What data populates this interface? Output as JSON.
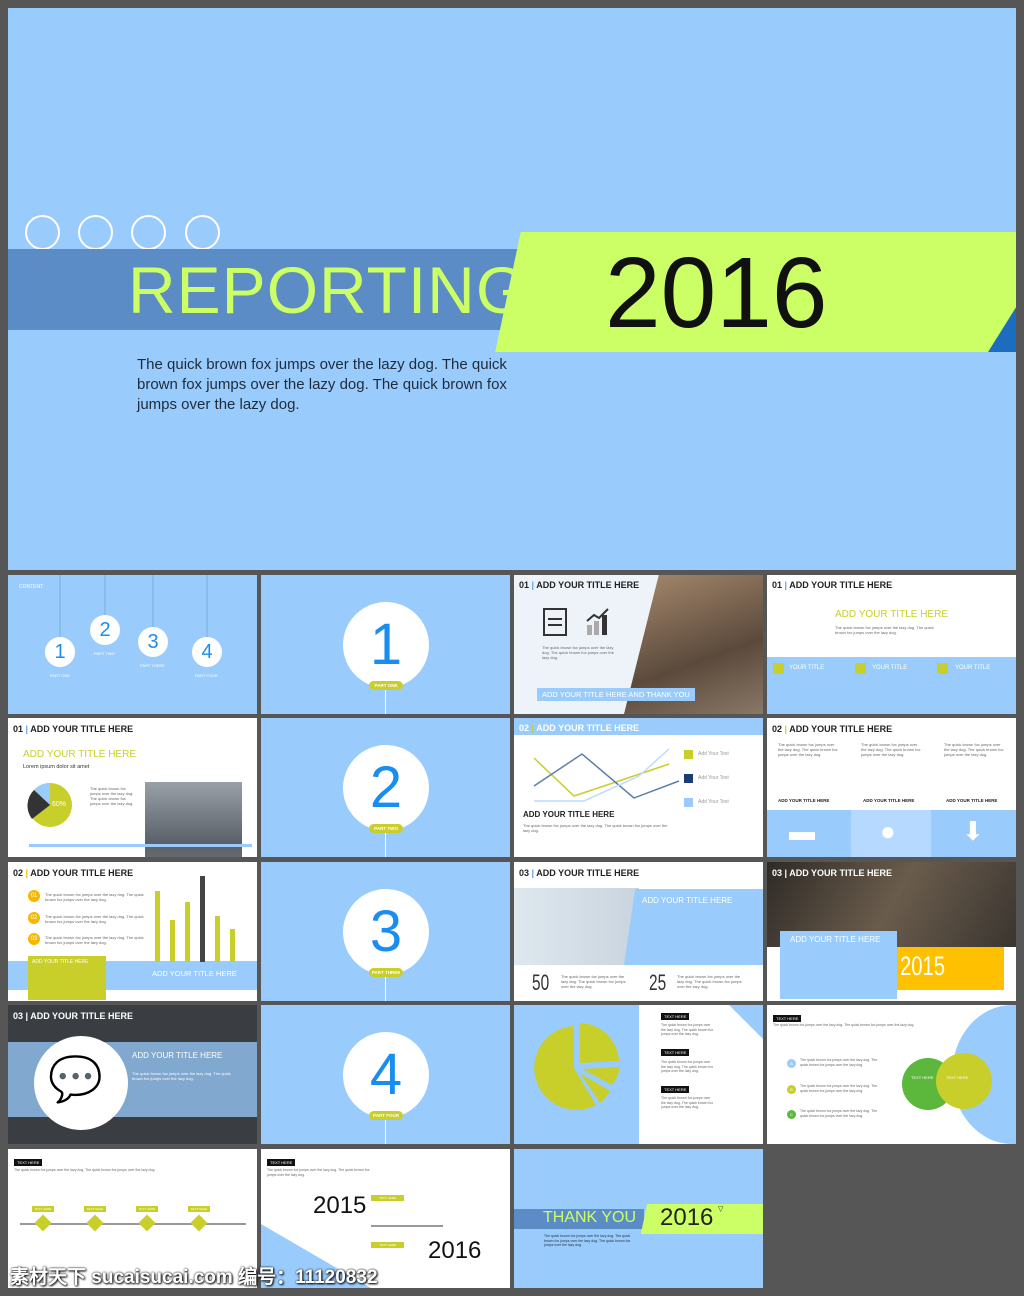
{
  "hero": {
    "title": "REPORTING",
    "year": "2016",
    "description": "The quick brown fox jumps over the lazy dog. The quick brown fox jumps over the lazy dog. The quick brown fox jumps over the lazy dog.",
    "colors": {
      "background": "#99ccfd",
      "band": "#5b8cc6",
      "accent": "#ccff66",
      "corner": "#1c6dc0"
    }
  },
  "contents": {
    "label": "CONTENT",
    "items": [
      {
        "num": "1",
        "label": "PART ONE"
      },
      {
        "num": "2",
        "label": "PART TWO"
      },
      {
        "num": "3",
        "label": "PART THREE"
      },
      {
        "num": "4",
        "label": "PART FOUR"
      }
    ]
  },
  "sections": [
    {
      "num": "1",
      "label": "PART ONE"
    },
    {
      "num": "2",
      "label": "PART TWO"
    },
    {
      "num": "3",
      "label": "PART THREE"
    },
    {
      "num": "4",
      "label": "PART FOUR"
    }
  ],
  "common": {
    "title": "ADD YOUR TITLE HERE",
    "lorem": "The quick brown fox jumps over the lazy dog. The quick brown fox jumps over the lazy dog.",
    "text_here": "TEXT HERE",
    "your_title": "YOUR TITLE",
    "add_your_text": "Add Your Text"
  },
  "s_01a": {
    "num": "01",
    "banner": "ADD YOUR TITLE HERE AND THANK YOU"
  },
  "s_01b": {
    "num": "01"
  },
  "s_01c": {
    "num": "01",
    "subtitle": "Lorem ipsum dolor sit amet",
    "pie_label": "60%"
  },
  "s_02a": {
    "num": "02"
  },
  "s_02b": {
    "num": "02"
  },
  "s_02c": {
    "num": "02",
    "bullets": [
      "01",
      "02",
      "03"
    ]
  },
  "s_03a": {
    "num": "03",
    "stat1": "50",
    "stat2": "25"
  },
  "s_03b": {
    "num": "03",
    "year": "2015"
  },
  "s_03c": {
    "num": "03"
  },
  "s_circles": {
    "letters": [
      "A",
      "B",
      "C"
    ]
  },
  "s_years": {
    "y1": "2015",
    "y2": "2016"
  },
  "s_end": {
    "title": "THANK YOU",
    "year": "2016"
  },
  "watermark": "素材天下 sucaisucai.com  编号：11120832"
}
